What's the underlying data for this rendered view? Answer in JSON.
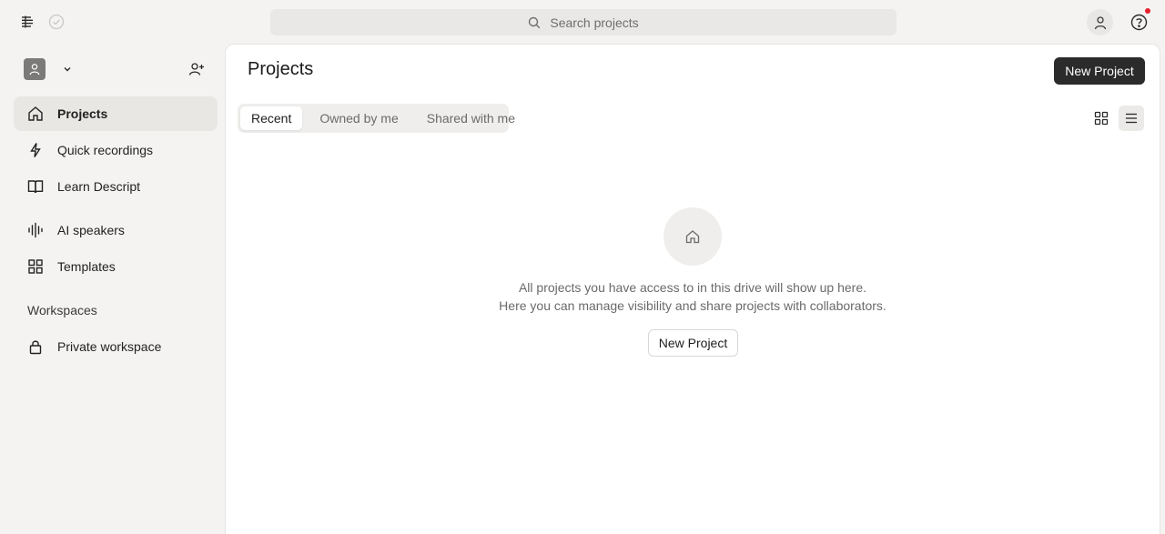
{
  "topbar": {
    "search_placeholder": "Search projects"
  },
  "sidebar": {
    "items": [
      {
        "label": "Projects",
        "icon": "home-icon",
        "active": true
      },
      {
        "label": "Quick recordings",
        "icon": "lightning-icon"
      },
      {
        "label": "Learn Descript",
        "icon": "book-icon"
      },
      {
        "label": "AI speakers",
        "icon": "waveform-icon"
      },
      {
        "label": "Templates",
        "icon": "grid-icon"
      }
    ],
    "workspaces_label": "Workspaces",
    "workspaces": [
      {
        "label": "Private workspace",
        "icon": "lock-icon"
      }
    ]
  },
  "main": {
    "title": "Projects",
    "new_project_label": "New Project",
    "tabs": [
      {
        "label": "Recent",
        "active": true
      },
      {
        "label": "Owned by me"
      },
      {
        "label": "Shared with me"
      }
    ],
    "empty_state": {
      "line1": "All projects you have access to in this drive will show up here.",
      "line2": "Here you can manage visibility and share projects with collaborators.",
      "button_label": "New Project"
    }
  },
  "colors": {
    "primary_button": "#2b2b2b",
    "notification": "#e5202e",
    "background": "#f4f3f1"
  }
}
